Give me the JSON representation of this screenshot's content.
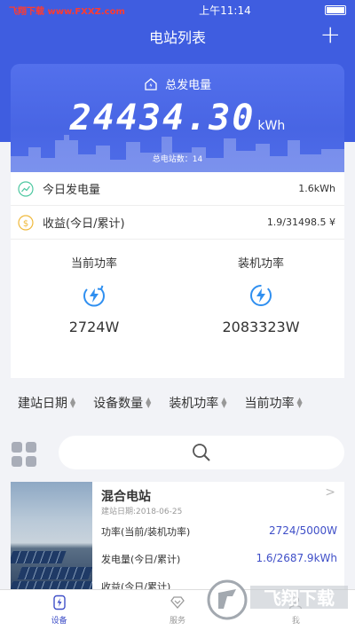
{
  "status_bar": {
    "left_text": "飞翔下载 www.FXXZ.com",
    "time": "上午11:14"
  },
  "nav": {
    "title": "电站列表",
    "add_label": "+"
  },
  "summary": {
    "label": "总发电量",
    "value": "24434.30",
    "unit": "kWh",
    "station_count_label": "总电站数：",
    "station_count": "14"
  },
  "info": {
    "today": {
      "label": "今日发电量",
      "value": "1.6kWh"
    },
    "income": {
      "label": "收益(今日/累计)",
      "value": "1.9/31498.5 ¥"
    },
    "current_power": {
      "label": "当前功率",
      "value": "2724W"
    },
    "installed_power": {
      "label": "装机功率",
      "value": "2083323W"
    }
  },
  "sort": [
    "建站日期",
    "设备数量",
    "装机功率",
    "当前功率"
  ],
  "search": {
    "placeholder": ""
  },
  "station": {
    "name": "混合电站",
    "date": "建站日期:2018-06-25",
    "rows": [
      {
        "label": "功率(当前/装机功率)",
        "value": "2724/5000W"
      },
      {
        "label": "发电量(今日/累计)",
        "value": "1.6/2687.9kWh"
      },
      {
        "label": "收益(今日/累计)",
        "value": ""
      }
    ]
  },
  "tabs": [
    {
      "label": "设备",
      "icon": "device-icon",
      "active": true
    },
    {
      "label": "服务",
      "icon": "service-icon",
      "active": false
    },
    {
      "label": "我",
      "icon": "profile-icon",
      "active": false
    }
  ],
  "watermark": {
    "brand": "飞翔下载",
    "url": "WWW.FXXZ.COM"
  },
  "colors": {
    "primary": "#3f5de0",
    "accent_blue": "#3f4fc8",
    "icon_blue": "#2f8ff0"
  }
}
